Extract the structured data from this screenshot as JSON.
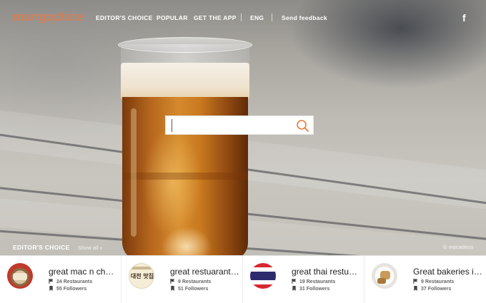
{
  "nav": {
    "logo": "mangoplate",
    "items": [
      "EDITOR'S CHOICE",
      "POPULAR",
      "GET THE APP"
    ],
    "language": "ENG",
    "feedback": "Send feedback",
    "social_icon": "facebook-icon"
  },
  "search": {
    "placeholder": "",
    "value": "",
    "icon": "search-icon"
  },
  "editors_choice": {
    "title": "EDITOR'S CHOICE",
    "show_all": "Show all »"
  },
  "photo_credit": "© mocadeco",
  "cards": [
    {
      "title": "great mac n cheese",
      "restaurants_count": "24",
      "restaurants_label": "Restaurants",
      "followers_count": "55",
      "followers_label": "Followers"
    },
    {
      "title": "great restuarants in daejeon",
      "restaurants_count": "9",
      "restaurants_label": "Restaurants",
      "followers_count": "51",
      "followers_label": "Followers",
      "thumb_text": "대전 맛집"
    },
    {
      "title": "great thai restuarants",
      "restaurants_count": "19",
      "restaurants_label": "Restaurants",
      "followers_count": "31",
      "followers_label": "Followers"
    },
    {
      "title": "Great bakeries in Seoul",
      "restaurants_count": "9",
      "restaurants_label": "Restaurants",
      "followers_count": "37",
      "followers_label": "Followers"
    }
  ],
  "colors": {
    "brand": "#f0773d",
    "nav_text": "#ffffff"
  }
}
